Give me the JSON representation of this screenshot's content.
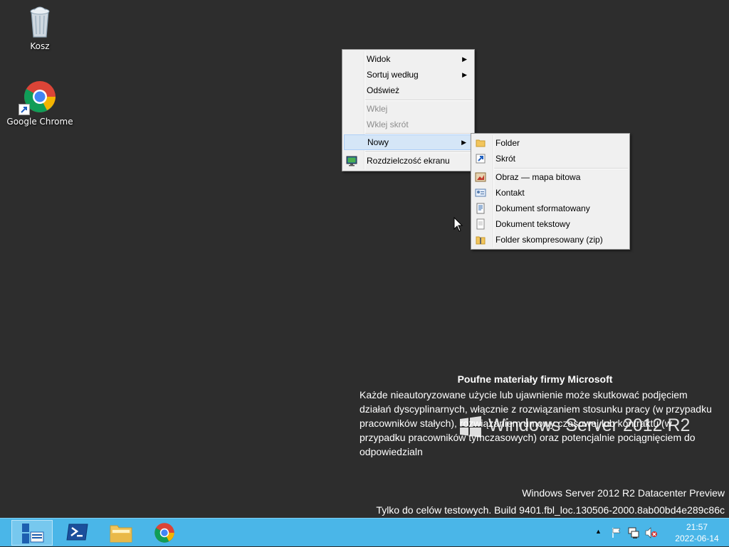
{
  "desktop": {
    "icons": [
      {
        "label": "Kosz",
        "icon": "recycle-bin-icon"
      },
      {
        "label": "Google Chrome",
        "icon": "chrome-icon"
      }
    ]
  },
  "context_menu": {
    "items": [
      {
        "label": "Widok",
        "submenu": true,
        "enabled": true
      },
      {
        "label": "Sortuj według",
        "submenu": true,
        "enabled": true
      },
      {
        "label": "Odśwież",
        "submenu": false,
        "enabled": true
      },
      {
        "label": "Wklej",
        "enabled": false
      },
      {
        "label": "Wklej skrót",
        "enabled": false
      },
      {
        "label": "Nowy",
        "submenu": true,
        "enabled": true,
        "highlighted": true
      },
      {
        "label": "Rozdzielczość ekranu",
        "enabled": true,
        "icon": "display-icon"
      }
    ]
  },
  "submenu_new": {
    "items": [
      {
        "label": "Folder",
        "icon": "folder-icon"
      },
      {
        "label": "Skrót",
        "icon": "shortcut-icon"
      },
      {
        "label": "Obraz — mapa bitowa",
        "icon": "bitmap-icon"
      },
      {
        "label": "Kontakt",
        "icon": "contact-icon"
      },
      {
        "label": "Dokument sformatowany",
        "icon": "rich-text-icon"
      },
      {
        "label": "Dokument tekstowy",
        "icon": "text-document-icon"
      },
      {
        "label": "Folder skompresowany (zip)",
        "icon": "zip-folder-icon"
      }
    ]
  },
  "watermark": {
    "heading": "Poufne materiały firmy Microsoft",
    "body": "Każde nieautoryzowane użycie lub ujawnienie może skutkować podjęciem działań dyscyplinarnych, włącznie z rozwiązaniem stosunku pracy (w przypadku pracowników stałych), rozwiązaniem umowy czasowej lub kontraktu (w przypadku pracowników tymczasowych) oraz potencjalnie pociągnięciem do odpowiedzialn",
    "product": "Windows Server 2012 R2",
    "edition": "Windows Server 2012 R2 Datacenter Preview",
    "build": "Tylko do celów testowych. Build 9401.fbl_loc.130506-2000.8ab00bd4e289c86c"
  },
  "taskbar": {
    "apps": [
      {
        "name": "server-manager",
        "active": true
      },
      {
        "name": "powershell"
      },
      {
        "name": "file-explorer"
      },
      {
        "name": "chrome"
      }
    ],
    "tray": {
      "show_hidden": "▲",
      "time": "21:57",
      "date": "2022-06-14"
    }
  },
  "colors": {
    "desktop": "#2d2d2d",
    "taskbar": "#4ab6e8",
    "menu_bg": "#f0f0f0",
    "highlight": "#d5e6f7"
  }
}
